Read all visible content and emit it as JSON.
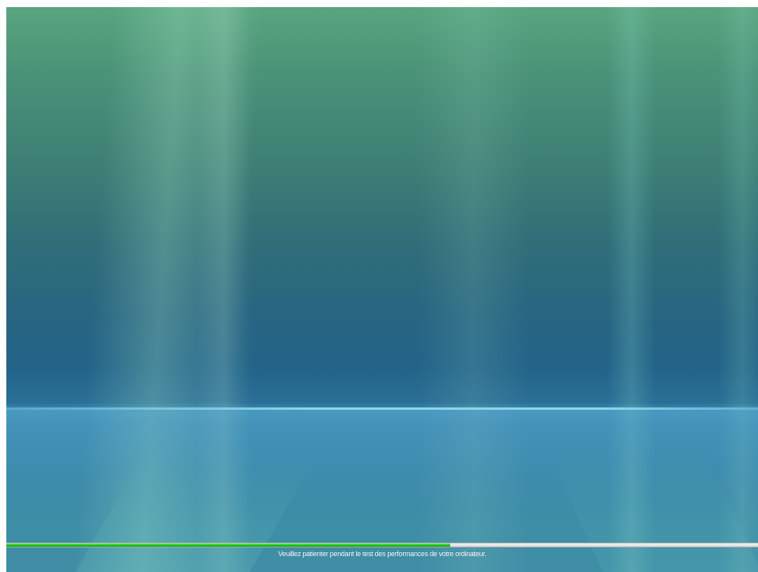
{
  "progress": {
    "fraction": 0.59,
    "fill_color": "#22c41a",
    "track_color": "#e6e6e6"
  },
  "status": {
    "message": "Veuillez patienter pendant le test des performances de votre ordinateur."
  }
}
